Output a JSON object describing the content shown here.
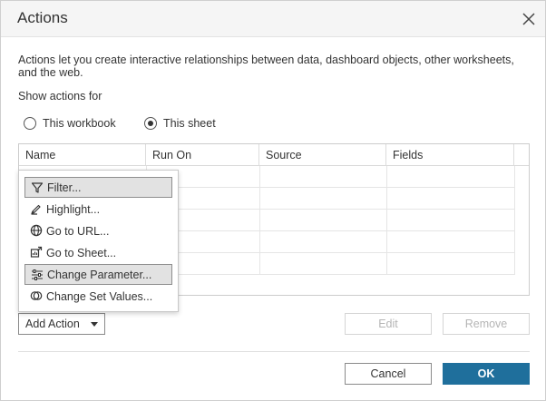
{
  "dialog": {
    "title": "Actions",
    "description": "Actions let you create interactive relationships between data, dashboard objects, other worksheets, and the web.",
    "show_actions_label": "Show actions for",
    "radio_options": [
      {
        "label": "This workbook",
        "selected": false
      },
      {
        "label": "This sheet",
        "selected": true
      }
    ]
  },
  "table": {
    "columns": [
      "Name",
      "Run On",
      "Source",
      "Fields"
    ]
  },
  "add_action": {
    "label": "Add Action"
  },
  "menu": {
    "items": [
      {
        "label": "Filter...",
        "icon": "filter-icon",
        "highlighted": true
      },
      {
        "label": "Highlight...",
        "icon": "highlighter-icon",
        "highlighted": false
      },
      {
        "label": "Go to URL...",
        "icon": "globe-icon",
        "highlighted": false
      },
      {
        "label": "Go to Sheet...",
        "icon": "sheet-link-icon",
        "highlighted": false
      },
      {
        "label": "Change Parameter...",
        "icon": "sliders-icon",
        "highlighted": true
      },
      {
        "label": "Change Set Values...",
        "icon": "set-values-icon",
        "highlighted": false
      }
    ]
  },
  "buttons": {
    "edit": "Edit",
    "remove": "Remove",
    "cancel": "Cancel",
    "ok": "OK"
  },
  "colors": {
    "ok_button": "#1f6f9c",
    "menu_highlight": "#e2e2e2"
  }
}
